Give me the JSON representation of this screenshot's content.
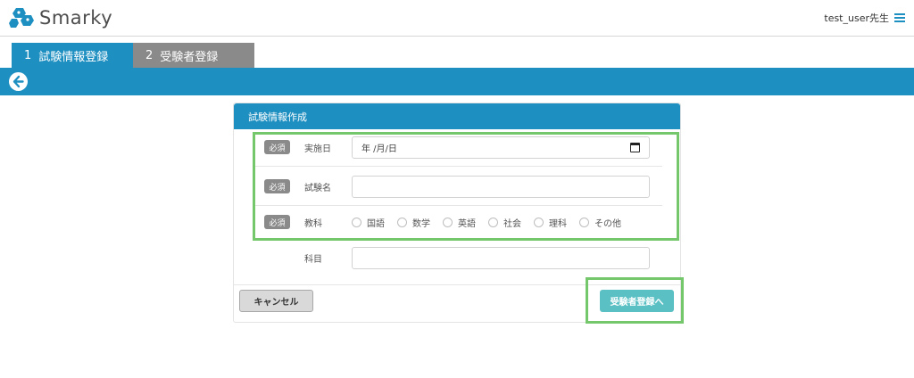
{
  "header": {
    "logo_text": "Smarky",
    "user_name": "test_user先生",
    "brand_color": "#1e8fc1"
  },
  "tabs": [
    {
      "num": "1",
      "label": "試験情報登録",
      "active": true
    },
    {
      "num": "2",
      "label": "受験者登録",
      "active": false
    }
  ],
  "panel": {
    "title": "試験情報作成",
    "required_badge": "必須",
    "fields": {
      "date_label": "実施日",
      "date_value": "年 /月/日",
      "name_label": "試験名",
      "name_value": "",
      "subject_label": "教科",
      "subject_options": [
        "国語",
        "数学",
        "英語",
        "社会",
        "理科",
        "その他"
      ],
      "course_label": "科目",
      "course_value": ""
    },
    "cancel_label": "キャンセル",
    "next_label": "受験者登録へ"
  },
  "highlight_color": "#74c86b",
  "icons": {
    "back": "arrow-left-icon",
    "menu": "hamburger-menu-icon",
    "calendar": "calendar-icon",
    "logo": "smarky-logo-icon"
  }
}
